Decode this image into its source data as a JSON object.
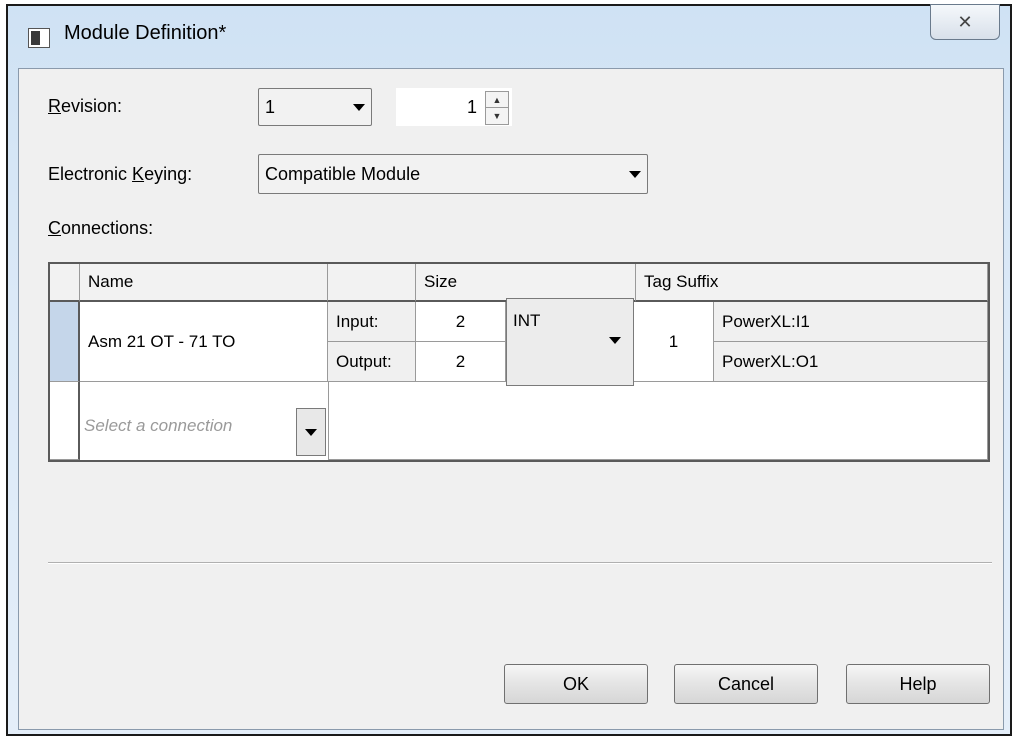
{
  "window": {
    "title": "Module Definition*",
    "close_glyph": "✕"
  },
  "revision": {
    "label_prefix": "",
    "label_u": "R",
    "label_rest": "evision:",
    "major": "1",
    "minor": "1"
  },
  "keying": {
    "label_pre": "Electronic ",
    "label_u": "K",
    "label_rest": "eying:",
    "value": "Compatible Module"
  },
  "connections": {
    "label_u": "C",
    "label_rest": "onnections:"
  },
  "grid": {
    "headers": {
      "name": "Name",
      "io": "",
      "size": "Size",
      "tag_suffix": "Tag Suffix"
    },
    "row": {
      "name": "Asm 21 OT - 71 TO",
      "input_label": "Input:",
      "input_size": "2",
      "output_label": "Output:",
      "output_size": "2",
      "data_type": "INT",
      "instance": "1",
      "input_tag": "PowerXL:I1",
      "output_tag": "PowerXL:O1"
    },
    "new_row_placeholder": "Select a connection"
  },
  "buttons": {
    "ok": "OK",
    "cancel": "Cancel",
    "help": "Help"
  }
}
